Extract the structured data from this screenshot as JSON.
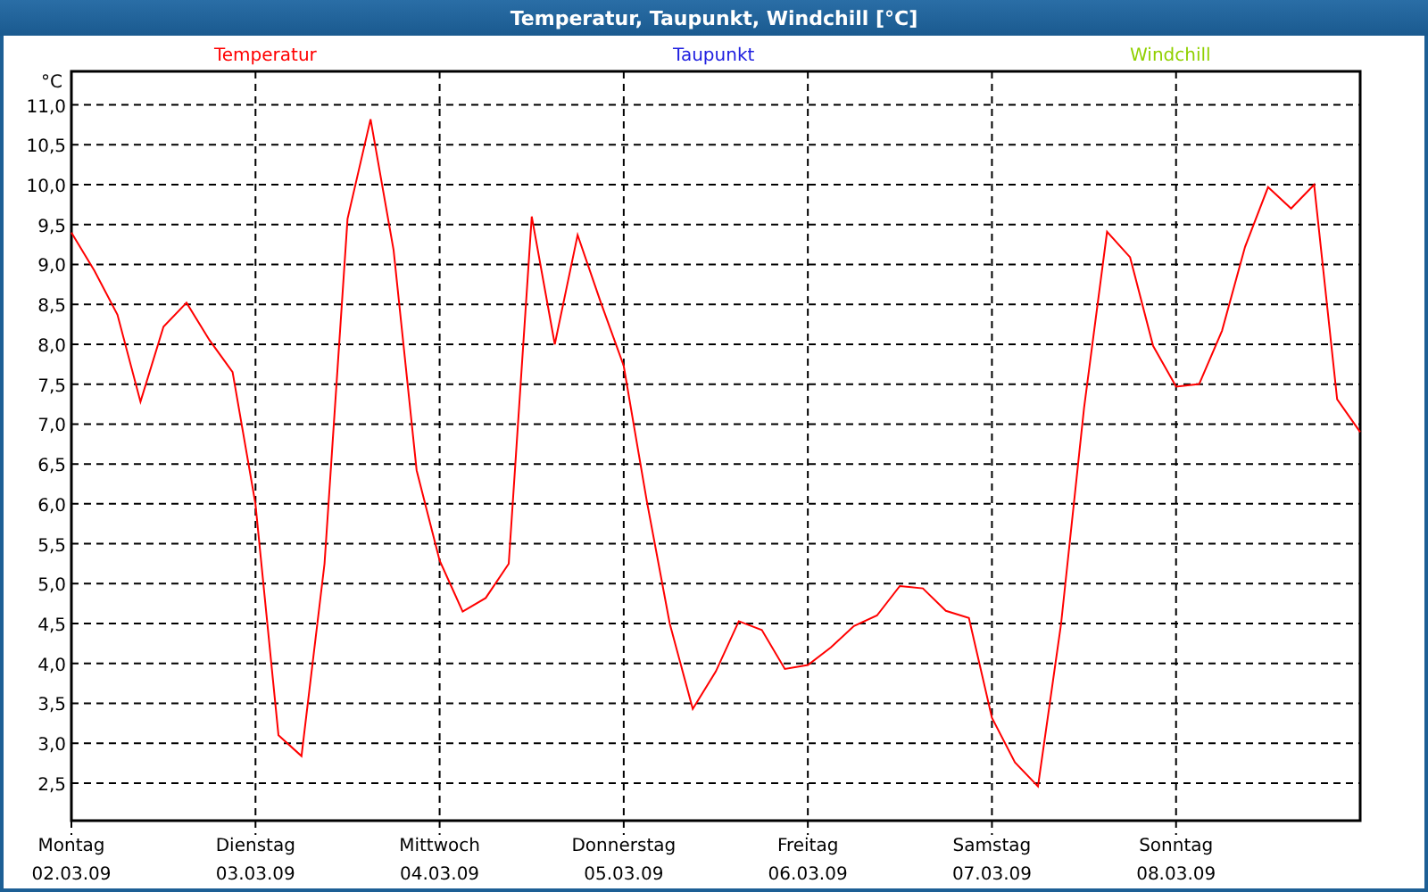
{
  "window": {
    "title": "Temperatur, Taupunkt, Windchill [°C]"
  },
  "legend": [
    {
      "label": "Taupunkt",
      "color": "#2020e0"
    },
    {
      "label": "Windchill",
      "color": "#90d000"
    }
  ],
  "dates": [
    "02.03.09",
    "03.03.09",
    "04.03.09",
    "05.03.09",
    "06.03.09",
    "07.03.09",
    "08.03.09"
  ],
  "chart_data": {
    "type": "line",
    "grid": true,
    "ylabel": "°C",
    "ylim": [
      2.03,
      11.42
    ],
    "yticks": [
      {
        "value": 2.5,
        "label": "2,5"
      },
      {
        "value": 3,
        "label": "3,0"
      },
      {
        "value": 3.5,
        "label": "3,5"
      },
      {
        "value": 4,
        "label": "4,0"
      },
      {
        "value": 4.5,
        "label": "4,5"
      },
      {
        "value": 5,
        "label": "5,0"
      },
      {
        "value": 5.5,
        "label": "5,5"
      },
      {
        "value": 6,
        "label": "6,0"
      },
      {
        "value": 6.5,
        "label": "6,5"
      },
      {
        "value": 7,
        "label": "7,0"
      },
      {
        "value": 7.5,
        "label": "7,5"
      },
      {
        "value": 8,
        "label": "8,0"
      },
      {
        "value": 8.5,
        "label": "8,5"
      },
      {
        "value": 9,
        "label": "9,0"
      },
      {
        "value": 9.5,
        "label": "9,5"
      },
      {
        "value": 10,
        "label": "10,0"
      },
      {
        "value": 10.5,
        "label": "10,5"
      },
      {
        "value": 11,
        "label": "11,0"
      }
    ],
    "categories": [
      "Montag",
      null,
      null,
      null,
      null,
      null,
      null,
      null,
      "Dienstag",
      null,
      null,
      null,
      null,
      null,
      null,
      null,
      "Mittwoch",
      null,
      null,
      null,
      null,
      null,
      null,
      null,
      "Donnerstag",
      null,
      null,
      null,
      null,
      null,
      null,
      null,
      "Freitag",
      null,
      null,
      null,
      null,
      null,
      null,
      null,
      "Samstag",
      null,
      null,
      null,
      null,
      null,
      null,
      null,
      "Sonntag",
      null,
      null,
      null,
      null,
      null,
      null,
      null,
      null
    ],
    "series": [
      {
        "name": "Temperatur",
        "color": "#ff0000",
        "values": [
          9.4,
          8.92,
          8.37,
          7.28,
          8.22,
          8.52,
          8.05,
          7.65,
          6.0,
          3.1,
          2.84,
          5.25,
          9.57,
          10.82,
          9.18,
          6.42,
          5.29,
          4.65,
          4.82,
          5.25,
          9.6,
          8.0,
          9.37,
          8.53,
          7.73,
          6.04,
          4.5,
          3.43,
          3.9,
          4.53,
          4.42,
          3.93,
          3.98,
          4.2,
          4.47,
          4.6,
          4.97,
          4.94,
          4.66,
          4.57,
          3.32,
          2.76,
          2.46,
          4.49,
          7.2,
          9.41,
          9.09,
          7.98,
          7.47,
          7.5,
          8.17,
          9.22,
          9.97,
          9.7,
          10.0,
          7.31,
          6.9
        ]
      }
    ]
  }
}
